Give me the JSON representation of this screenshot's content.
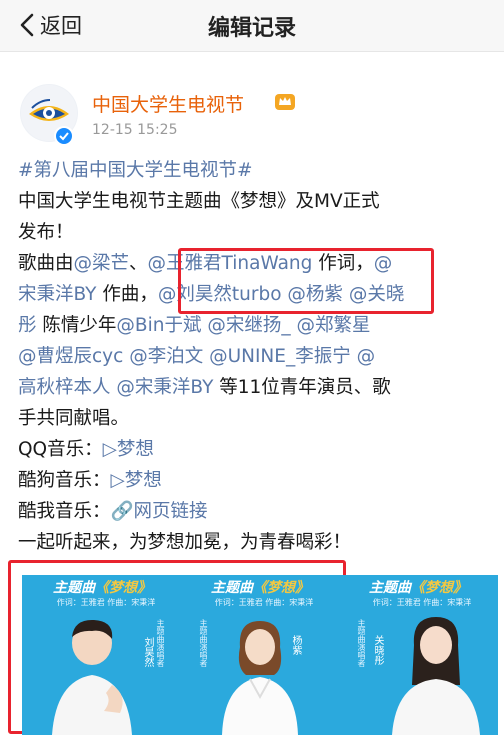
{
  "header": {
    "back_label": "返回",
    "title": "编辑记录"
  },
  "post": {
    "author": "中国大学生电视节",
    "time": "12-15 15:25",
    "lines": [
      [
        {
          "t": "#第八届中国大学生电视节#",
          "c": "tag"
        }
      ],
      [
        {
          "t": "中国大学生电视节主题曲《梦想》及MV正式",
          "c": ""
        }
      ],
      [
        {
          "t": "发布！",
          "c": ""
        }
      ],
      [
        {
          "t": "歌曲由",
          "c": ""
        },
        {
          "t": "@梁芒",
          "c": "at"
        },
        {
          "t": "、",
          "c": ""
        },
        {
          "t": "@王雅君TinaWang",
          "c": "at"
        },
        {
          "t": " 作词，",
          "c": ""
        },
        {
          "t": "@",
          "c": "at"
        }
      ],
      [
        {
          "t": "宋秉洋BY",
          "c": "at"
        },
        {
          "t": " 作曲，",
          "c": ""
        },
        {
          "t": "@刘昊然turbo",
          "c": "at"
        },
        {
          "t": " ",
          "c": ""
        },
        {
          "t": "@杨紫",
          "c": "at"
        },
        {
          "t": " ",
          "c": ""
        },
        {
          "t": "@关晓",
          "c": "at"
        }
      ],
      [
        {
          "t": "彤",
          "c": "at"
        },
        {
          "t": " 陈情少年",
          "c": ""
        },
        {
          "t": "@Bin于斌",
          "c": "at"
        },
        {
          "t": " ",
          "c": ""
        },
        {
          "t": "@宋继扬_",
          "c": "at"
        },
        {
          "t": " ",
          "c": ""
        },
        {
          "t": "@郑繁星",
          "c": "at"
        }
      ],
      [
        {
          "t": "@曹煜辰cyc",
          "c": "at"
        },
        {
          "t": " ",
          "c": ""
        },
        {
          "t": "@李泊文",
          "c": "at"
        },
        {
          "t": " ",
          "c": ""
        },
        {
          "t": "@UNINE_李振宁",
          "c": "at"
        },
        {
          "t": " ",
          "c": ""
        },
        {
          "t": "@",
          "c": "at"
        }
      ],
      [
        {
          "t": "高秋梓本人",
          "c": "at"
        },
        {
          "t": " ",
          "c": ""
        },
        {
          "t": "@宋秉洋BY",
          "c": "at"
        },
        {
          "t": " 等11位青年演员、歌",
          "c": ""
        }
      ],
      [
        {
          "t": "手共同献唱。",
          "c": ""
        }
      ],
      [
        {
          "t": "QQ音乐：",
          "c": ""
        },
        {
          "t": "▷梦想",
          "c": "link"
        }
      ],
      [
        {
          "t": "酷狗音乐：",
          "c": ""
        },
        {
          "t": "▷梦想",
          "c": "link"
        }
      ],
      [
        {
          "t": "酷我音乐：",
          "c": ""
        },
        {
          "t": "🔗网页链接",
          "c": "link"
        }
      ],
      [
        {
          "t": "一起听起来，为梦想加冕，为青春喝彩！",
          "c": ""
        }
      ]
    ]
  },
  "images": [
    {
      "title_a": "主题曲",
      "title_b": "《梦想》",
      "sub": "作词：王雅君 作曲：宋秉洋",
      "side": "主题曲演唱者",
      "name": "刘昊然"
    },
    {
      "title_a": "主题曲",
      "title_b": "《梦想》",
      "sub": "作词：王雅君 作曲：宋秉洋",
      "side": "主题曲演唱者",
      "name": "杨紫"
    },
    {
      "title_a": "主题曲",
      "title_b": "《梦想》",
      "sub": "作词：王雅君 作曲：宋秉洋",
      "side": "主题曲演唱者",
      "name": "关晓彤"
    }
  ],
  "colors": {
    "accent": "#e8620a",
    "link": "#5a78a8",
    "highlight": "#e8232e",
    "poster_bg": "#2ba9dd"
  }
}
